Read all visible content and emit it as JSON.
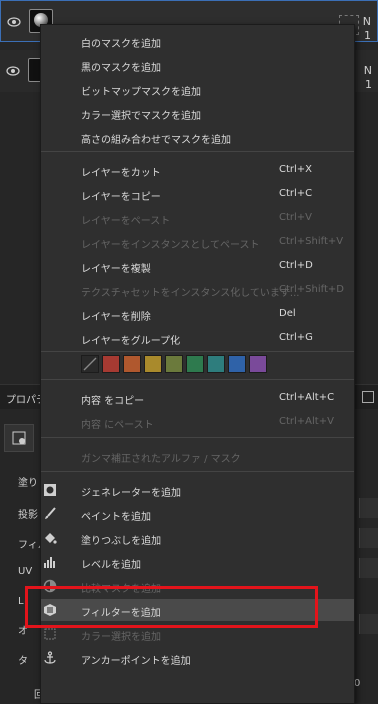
{
  "layers": [
    {
      "name_partial": "N",
      "sub_partial": "1"
    },
    {
      "name_partial": "N",
      "sub_partial": "1"
    }
  ],
  "properties": {
    "header": "プロパテ",
    "labels": [
      "塗り",
      "投影",
      "フィル",
      "UV",
      "L",
      "オ",
      "タ",
      "回転"
    ],
    "value": "0"
  },
  "menu": {
    "mask_items": [
      {
        "label": "白のマスクを追加"
      },
      {
        "label": "黒のマスクを追加"
      },
      {
        "label": "ビットマップマスクを追加"
      },
      {
        "label": "カラー選択でマスクを追加"
      },
      {
        "label": "高さの組み合わせでマスクを追加"
      }
    ],
    "layer_items": [
      {
        "label": "レイヤーをカット",
        "shortcut": "Ctrl+X",
        "enabled": true
      },
      {
        "label": "レイヤーをコピー",
        "shortcut": "Ctrl+C",
        "enabled": true
      },
      {
        "label": "レイヤーをペースト",
        "shortcut": "Ctrl+V",
        "enabled": false
      },
      {
        "label": "レイヤーをインスタンスとしてペースト",
        "shortcut": "Ctrl+Shift+V",
        "enabled": false
      },
      {
        "label": "レイヤーを複製",
        "shortcut": "Ctrl+D",
        "enabled": true
      },
      {
        "label": "テクスチャセットをインスタンス化しています...",
        "shortcut": "Ctrl+Shift+D",
        "enabled": false
      },
      {
        "label": "レイヤーを削除",
        "shortcut": "Del",
        "enabled": true
      },
      {
        "label": "レイヤーをグループ化",
        "shortcut": "Ctrl+G",
        "enabled": true
      }
    ],
    "swatches": [
      "#2a2a2a",
      "#a63a32",
      "#b0582e",
      "#a98a2c",
      "#6b7a3c",
      "#2e7a4e",
      "#2e7d7d",
      "#2f62a8",
      "#7a4a9a"
    ],
    "content_items": [
      {
        "label": "内容 をコピー",
        "shortcut": "Ctrl+Alt+C",
        "enabled": true
      },
      {
        "label": "内容 にペースト",
        "shortcut": "Ctrl+Alt+V",
        "enabled": false
      }
    ],
    "gamma_item": {
      "label": "ガンマ補正されたアルファ / マスク",
      "enabled": false
    },
    "add_items": [
      {
        "label": "ジェネレーターを追加",
        "icon": "generator-icon",
        "enabled": true
      },
      {
        "label": "ペイントを追加",
        "icon": "paint-brush-icon",
        "enabled": true
      },
      {
        "label": "塗りつぶしを追加",
        "icon": "fill-bucket-icon",
        "enabled": true
      },
      {
        "label": "レベルを追加",
        "icon": "levels-icon",
        "enabled": true
      },
      {
        "label": "比較マスクを追加",
        "icon": "compare-mask-icon",
        "enabled": false
      },
      {
        "label": "フィルターを追加",
        "icon": "filter-icon",
        "enabled": true,
        "highlighted": true
      },
      {
        "label": "カラー選択を追加",
        "icon": "color-selection-icon",
        "enabled": false
      },
      {
        "label": "アンカーポイントを追加",
        "icon": "anchor-icon",
        "enabled": true
      }
    ]
  },
  "colors": {
    "highlight_box": "#e3141b",
    "selection_border": "#3b6fb6"
  }
}
